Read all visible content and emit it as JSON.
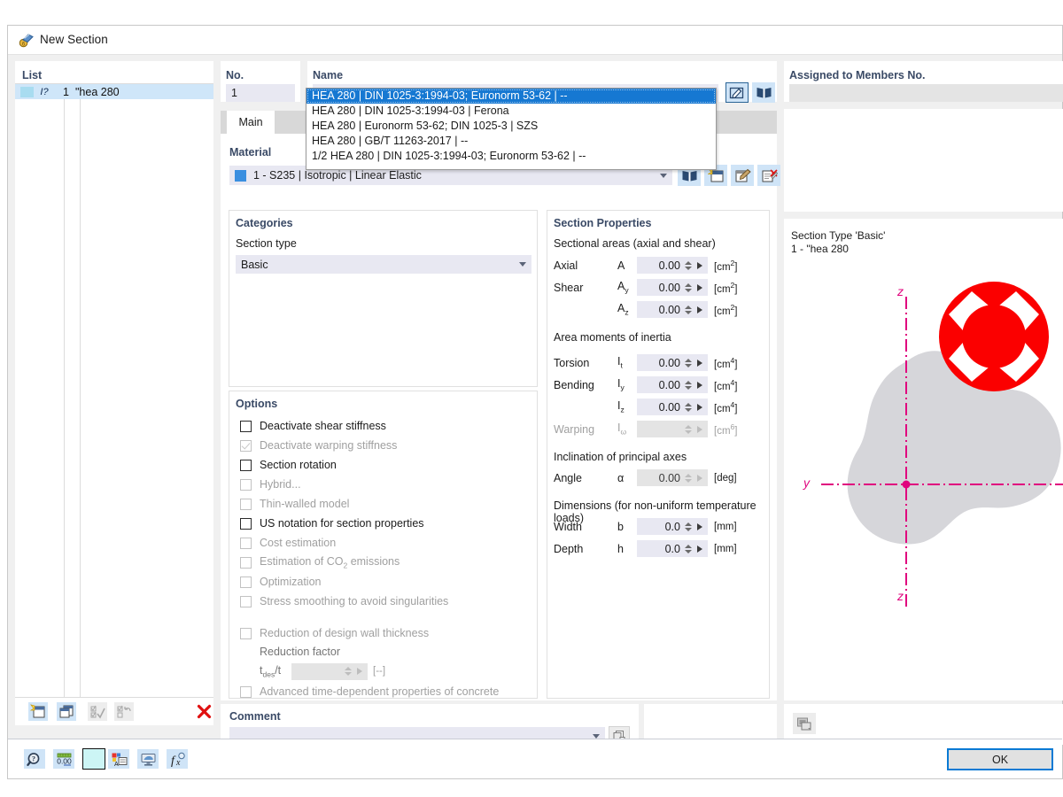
{
  "window": {
    "title": "New Section",
    "icon": "section-icon"
  },
  "list": {
    "header": "List",
    "rows": [
      {
        "no": "1",
        "name": "\"hea 280",
        "type_icon": "I?"
      }
    ],
    "toolbar": [
      {
        "name": "new-section-button",
        "icon": "new-document-icon"
      },
      {
        "name": "copy-section-button",
        "icon": "copy-document-icon"
      },
      {
        "name": "select-all-button",
        "icon": "check-list-icon"
      },
      {
        "name": "invert-selection-button",
        "icon": "swap-list-icon"
      },
      {
        "name": "delete-section-button",
        "icon": "red-x-icon"
      }
    ]
  },
  "no_field": {
    "header": "No.",
    "value": "1"
  },
  "name_field": {
    "header": "Name",
    "value": "\"hea 280",
    "buttons": [
      {
        "name": "edit-name-button",
        "icon": "pencil-edit-icon",
        "selected": true
      },
      {
        "name": "section-library-button",
        "icon": "book-icon",
        "selected": false
      }
    ],
    "dropdown": {
      "visible": true,
      "items": [
        {
          "label": "HEA 280 | DIN 1025-3:1994-03; Euronorm 53-62 | --",
          "active": true
        },
        {
          "label": "HEA 280 | DIN 1025-3:1994-03 | Ferona",
          "active": false
        },
        {
          "label": "HEA 280 | Euronorm 53-62; DIN 1025-3 | SZS",
          "active": false
        },
        {
          "label": "HEA 280 | GB/T 11263-2017 | --",
          "active": false
        },
        {
          "label": "1/2 HEA 280 | DIN 1025-3:1994-03; Euronorm 53-62 | --",
          "active": false
        }
      ]
    }
  },
  "tabs": [
    {
      "label": "Main",
      "active": true
    }
  ],
  "material": {
    "label": "Material",
    "value": "1 - S235 | Isotropic | Linear Elastic",
    "swatch_color": "#3a8fe0",
    "buttons": [
      {
        "name": "material-library-button",
        "icon": "book-icon"
      },
      {
        "name": "new-material-button",
        "icon": "new-material-icon"
      },
      {
        "name": "edit-material-button",
        "icon": "edit-material-icon"
      },
      {
        "name": "delete-material-button",
        "icon": "delete-material-icon"
      }
    ]
  },
  "categories": {
    "header": "Categories",
    "section_type_label": "Section type",
    "section_type_value": "Basic"
  },
  "options": {
    "header": "Options",
    "items": [
      {
        "label": "Deactivate shear stiffness",
        "state": "unchecked",
        "enabled": true
      },
      {
        "label": "Deactivate warping stiffness",
        "state": "checked",
        "enabled": false
      },
      {
        "label": "Section rotation",
        "state": "unchecked",
        "enabled": true
      },
      {
        "label": "Hybrid...",
        "state": "unchecked",
        "enabled": false
      },
      {
        "label": "Thin-walled model",
        "state": "unchecked",
        "enabled": false
      },
      {
        "label": "US notation for section properties",
        "state": "unchecked",
        "enabled": true
      },
      {
        "label": "Cost estimation",
        "state": "unchecked",
        "enabled": false
      },
      {
        "label": "Estimation of CO2 emissions",
        "state": "unchecked",
        "enabled": false,
        "html_label": true
      },
      {
        "label": "Optimization",
        "state": "unchecked",
        "enabled": false
      },
      {
        "label": "Stress smoothing to avoid singularities",
        "state": "unchecked",
        "enabled": false
      }
    ],
    "reduction": {
      "checkbox_label": "Reduction of design wall thickness",
      "factor_label": "Reduction factor",
      "symbol": "tdes/t",
      "value": "",
      "unit": "[--]"
    },
    "advanced_label": "Advanced time-dependent properties of concrete"
  },
  "section_properties": {
    "header": "Section Properties",
    "groups": [
      {
        "title": "Sectional areas (axial and shear)",
        "rows": [
          {
            "label": "Axial",
            "symbol": "A",
            "sub": "",
            "value": "0.00",
            "unit": "cm",
            "exp": "2",
            "enabled": true
          },
          {
            "label": "Shear",
            "symbol": "A",
            "sub": "y",
            "value": "0.00",
            "unit": "cm",
            "exp": "2",
            "enabled": true
          },
          {
            "label": "",
            "symbol": "A",
            "sub": "z",
            "value": "0.00",
            "unit": "cm",
            "exp": "2",
            "enabled": true
          }
        ]
      },
      {
        "title": "Area moments of inertia",
        "rows": [
          {
            "label": "Torsion",
            "symbol": "I",
            "sub": "t",
            "value": "0.00",
            "unit": "cm",
            "exp": "4",
            "enabled": true
          },
          {
            "label": "Bending",
            "symbol": "I",
            "sub": "y",
            "value": "0.00",
            "unit": "cm",
            "exp": "4",
            "enabled": true
          },
          {
            "label": "",
            "symbol": "I",
            "sub": "z",
            "value": "0.00",
            "unit": "cm",
            "exp": "4",
            "enabled": true
          },
          {
            "label": "Warping",
            "symbol": "I",
            "sub": "ω",
            "value": "",
            "unit": "cm",
            "exp": "6",
            "enabled": false
          }
        ]
      },
      {
        "title": "Inclination of principal axes",
        "rows": [
          {
            "label": "Angle",
            "symbol": "α",
            "sub": "",
            "value": "0.00",
            "unit": "deg",
            "exp": "",
            "enabled": false
          }
        ]
      },
      {
        "title": "Dimensions (for non-uniform temperature loads)",
        "rows": [
          {
            "label": "Width",
            "symbol": "b",
            "sub": "",
            "value": "0.0",
            "unit": "mm",
            "exp": "",
            "enabled": true
          },
          {
            "label": "Depth",
            "symbol": "h",
            "sub": "",
            "value": "0.0",
            "unit": "mm",
            "exp": "",
            "enabled": true
          }
        ]
      }
    ]
  },
  "assigned": {
    "header": "Assigned to Members No.",
    "value": ""
  },
  "preview": {
    "info_line_1": "Section Type 'Basic'",
    "info_line_2": "1 - \"hea 280",
    "axis_y_label": "y",
    "axis_z_top_label": "z",
    "axis_z_bottom_label": "z",
    "axis_color": "#e0047e",
    "shape_color": "#d6d6da",
    "error_color": "#fb0000",
    "error_icon": "error-x-circle-icon",
    "toolbar": [
      {
        "name": "preview-screenshot-button",
        "icon": "screenshot-icon"
      }
    ]
  },
  "comment": {
    "header": "Comment",
    "value": "",
    "button": {
      "name": "comment-templates-button",
      "icon": "copy-pages-icon"
    }
  },
  "bottom_toolbar": [
    {
      "name": "help-button",
      "icon": "magnifier-question-icon"
    },
    {
      "name": "units-button",
      "icon": "units-0-00-icon"
    },
    {
      "name": "color-button",
      "icon": "color-swatch-icon"
    },
    {
      "name": "display-properties-button",
      "icon": "display-props-icon"
    },
    {
      "name": "view-button",
      "icon": "view-monitor-icon"
    },
    {
      "name": "formula-button",
      "icon": "fx-formula-icon"
    }
  ],
  "dialog_buttons": {
    "ok": "OK"
  }
}
